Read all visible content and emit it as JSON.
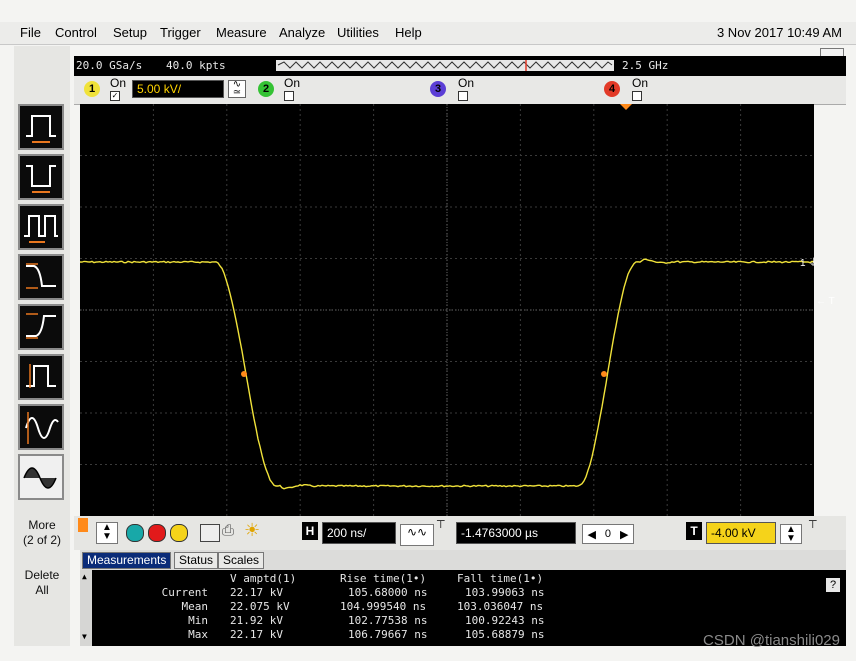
{
  "menu": {
    "items": [
      "File",
      "Control",
      "Setup",
      "Trigger",
      "Measure",
      "Analyze",
      "Utilities",
      "Help"
    ],
    "datetime": "3 Nov 2017 10:49 AM",
    "minimize": "–"
  },
  "acquisition": {
    "sample_rate": "20.0 GSa/s",
    "points": "40.0 kpts",
    "bandwidth": "2.5 GHz"
  },
  "channels": [
    {
      "num": "1",
      "on_label": "On",
      "checked": true,
      "scale": "5.00 kV/",
      "color": "#f0e23a"
    },
    {
      "num": "2",
      "on_label": "On",
      "checked": false,
      "color": "#34c234"
    },
    {
      "num": "3",
      "on_label": "On",
      "checked": false,
      "color": "#5b3ed6"
    },
    {
      "num": "4",
      "on_label": "On",
      "checked": false,
      "color": "#e23a28"
    }
  ],
  "sidebar": {
    "more_label": "More",
    "more_sub": "(2 of 2)",
    "delete_label": "Delete",
    "delete_sub": "All"
  },
  "scope": {
    "trace_color": "#f0e23a",
    "marker_color": "#ff8a1a",
    "ch_marker": "1",
    "trig_marker": "T"
  },
  "horizontal": {
    "h_badge": "H",
    "timebase": "200 ns/",
    "delay": "-1.4763000 µs",
    "nav_value": "0"
  },
  "trigger": {
    "t_badge": "T",
    "level": "-4.00 kV"
  },
  "tabs": [
    "Measurements",
    "Status",
    "Scales"
  ],
  "measurements": {
    "headers": [
      "V amptd(1)",
      "Rise time(1•)",
      "Fall time(1•)"
    ],
    "rows": [
      {
        "label": "Current",
        "values": [
          "22.17 kV",
          "105.68000 ns",
          "103.99063 ns"
        ]
      },
      {
        "label": "Mean",
        "values": [
          "22.075 kV",
          "104.999540 ns",
          "103.036047 ns"
        ]
      },
      {
        "label": "Min",
        "values": [
          "21.92 kV",
          "102.77538 ns",
          "100.92243 ns"
        ]
      },
      {
        "label": "Max",
        "values": [
          "22.17 kV",
          "106.79667 ns",
          "105.68879 ns"
        ]
      }
    ],
    "help": "?"
  },
  "watermark": "CSDN @tianshili029"
}
